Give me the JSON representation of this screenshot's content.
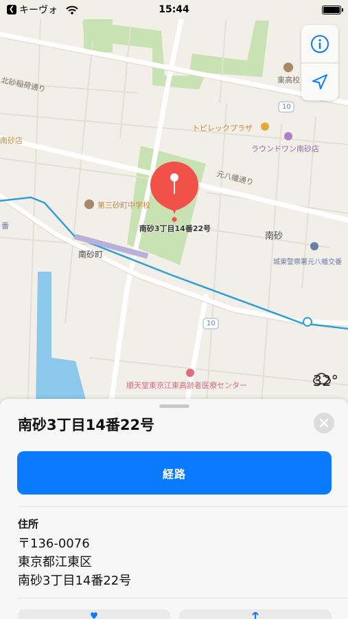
{
  "status_bar": {
    "back_app": "キーヴォ",
    "time": "15:44"
  },
  "map": {
    "labels": {
      "kitasuna_street": "北砂稲荷通り",
      "higashi_school": "東高校",
      "route_10_a": "10",
      "tobiric_plaza": "トピレックプラザ",
      "round_one": "ラウンドワン南砂店",
      "minamisuna_store": "南砂店",
      "motohachiman_street": "元八幡通り",
      "school_3": "第三砂町中学校",
      "minamisuna": "南砂",
      "minamisuna_cho": "南砂町",
      "police_box": "城東警察署元八幡交番",
      "route_10_b": "10",
      "juntendo": "順天堂東京江東高齢者医療センター",
      "edge_ban": "番"
    },
    "pin_label": "南砂3丁目14番22号",
    "weather": "32°"
  },
  "controls": {
    "info_icon": "info-icon",
    "location_icon": "location-arrow-icon"
  },
  "sheet": {
    "title": "南砂3丁目14番22号",
    "route_button": "経路",
    "address_heading": "住所",
    "address_lines": [
      "〒136-0076",
      "東京都江東区",
      "南砂3丁目14番22号"
    ]
  },
  "colors": {
    "accent": "#0a7bff",
    "pin": "#f0524a",
    "park": "#c9e2b3",
    "road_blue": "#2b9fd6"
  }
}
